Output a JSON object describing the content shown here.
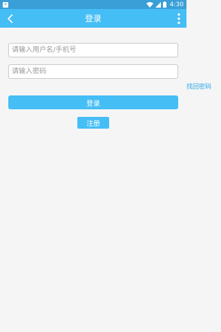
{
  "status_bar": {
    "notification_icon": "notification-icon",
    "time": "4:30"
  },
  "app_bar": {
    "title": "登录",
    "back_icon": "chevron-left-icon",
    "more_icon": "more-vertical-icon",
    "background": "#45bdf5"
  },
  "form": {
    "username_placeholder": "请输入用户名/手机号",
    "password_placeholder": "请输入密码",
    "forgot_label": "找回密码",
    "login_label": "登录",
    "register_label": "注册"
  },
  "colors": {
    "accent": "#45bdf5",
    "link": "#29a8e8",
    "status_bar": "#3a9fd6",
    "background": "#f5f5f5"
  }
}
